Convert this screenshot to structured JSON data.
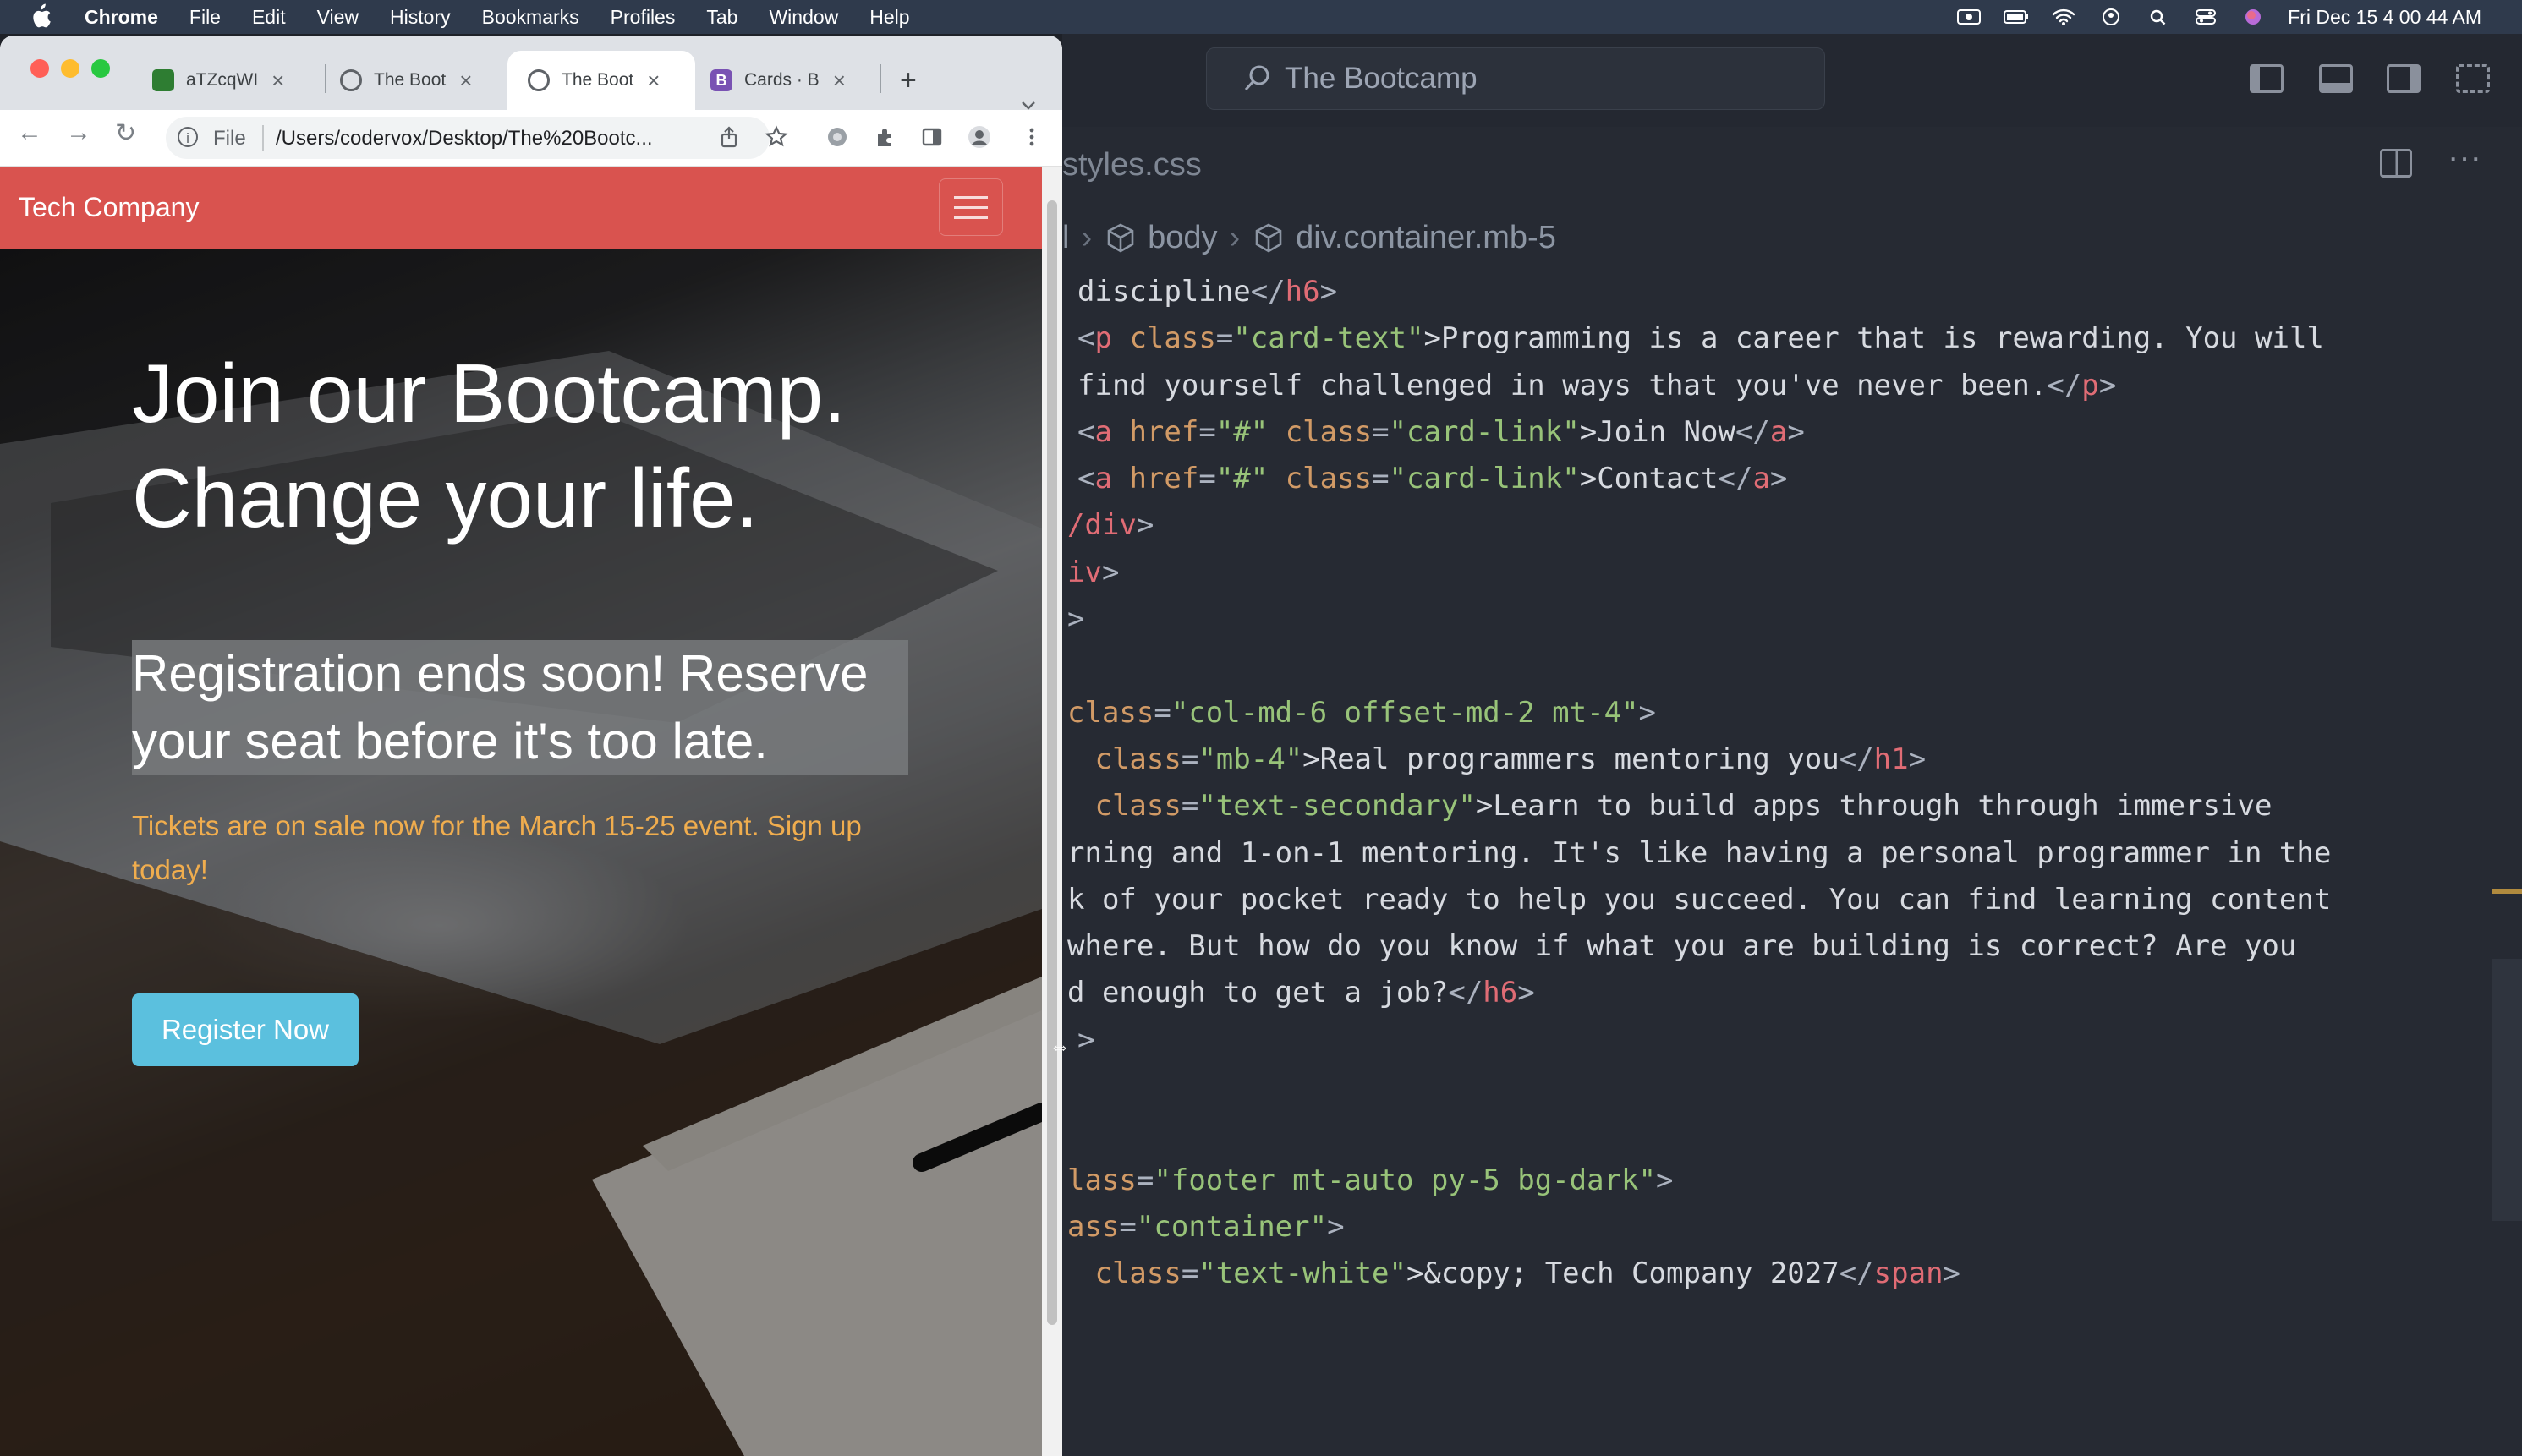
{
  "menubar": {
    "app": "Chrome",
    "items": [
      "File",
      "Edit",
      "View",
      "History",
      "Bookmarks",
      "Profiles",
      "Tab",
      "Window",
      "Help"
    ],
    "clock": "Fri Dec 15  4 00 44 AM"
  },
  "browser": {
    "tabs": [
      {
        "label": "aTZcqWI",
        "active": false,
        "favicon_color": "#2e7d32"
      },
      {
        "label": "The Boot",
        "active": false,
        "favicon_color": "#5f6368"
      },
      {
        "label": "The Boot",
        "active": true,
        "favicon_color": "#5f6368"
      },
      {
        "label": "Cards · B",
        "active": false,
        "favicon_color": "#7952b3"
      }
    ],
    "new_tab": "+",
    "address": {
      "scheme": "File",
      "url": "/Users/codervox/Desktop/The%20Bootc..."
    }
  },
  "page": {
    "brand": "Tech Company",
    "headline_line1": "Join our Bootcamp.",
    "headline_line2": "Change your life.",
    "lead_line1": "Registration ends soon! Reserve",
    "lead_line2": "your seat before it's too late.",
    "tickets_line1": "Tickets are on sale now for the March 15-25 event. Sign up",
    "tickets_line2": "today!",
    "register_button": "Register Now",
    "colors": {
      "navbar": "#d9534f",
      "tickets": "#f0ad4e",
      "button": "#5bc0de"
    }
  },
  "editor": {
    "command_center": "The Bootcamp",
    "tab": "styles.css",
    "breadcrumb": [
      "l",
      "body",
      "div.container.mb-5"
    ],
    "code": [
      [
        {
          "t": "discipline",
          "c": "tx"
        },
        {
          "t": "</",
          "c": "pu"
        },
        {
          "t": "h6",
          "c": "tg"
        },
        {
          "t": ">",
          "c": "pu"
        }
      ],
      [
        {
          "t": "<",
          "c": "pu"
        },
        {
          "t": "p",
          "c": "tg"
        },
        {
          "t": " class",
          "c": "at"
        },
        {
          "t": "=",
          "c": "pu"
        },
        {
          "t": "\"card-text\"",
          "c": "st"
        },
        {
          "t": ">Programming is a career that is rewarding. You will",
          "c": "tx"
        }
      ],
      [
        {
          "t": "find yourself challenged in ways that you've never been.",
          "c": "tx"
        },
        {
          "t": "</",
          "c": "pu"
        },
        {
          "t": "p",
          "c": "tg"
        },
        {
          "t": ">",
          "c": "pu"
        }
      ],
      [
        {
          "t": "<",
          "c": "pu"
        },
        {
          "t": "a",
          "c": "tg"
        },
        {
          "t": " href",
          "c": "at"
        },
        {
          "t": "=",
          "c": "pu"
        },
        {
          "t": "\"#\"",
          "c": "st"
        },
        {
          "t": " class",
          "c": "at"
        },
        {
          "t": "=",
          "c": "pu"
        },
        {
          "t": "\"card-link\"",
          "c": "st"
        },
        {
          "t": ">Join Now",
          "c": "tx"
        },
        {
          "t": "</",
          "c": "pu"
        },
        {
          "t": "a",
          "c": "tg"
        },
        {
          "t": ">",
          "c": "pu"
        }
      ],
      [
        {
          "t": "<",
          "c": "pu"
        },
        {
          "t": "a",
          "c": "tg"
        },
        {
          "t": " href",
          "c": "at"
        },
        {
          "t": "=",
          "c": "pu"
        },
        {
          "t": "\"#\"",
          "c": "st"
        },
        {
          "t": " class",
          "c": "at"
        },
        {
          "t": "=",
          "c": "pu"
        },
        {
          "t": "\"card-link\"",
          "c": "st"
        },
        {
          "t": ">Contact",
          "c": "tx"
        },
        {
          "t": "</",
          "c": "pu"
        },
        {
          "t": "a",
          "c": "tg"
        },
        {
          "t": ">",
          "c": "pu"
        }
      ],
      [
        {
          "t": "/div",
          "c": "tg"
        },
        {
          "t": ">",
          "c": "pu"
        }
      ],
      [
        {
          "t": "iv",
          "c": "tg"
        },
        {
          "t": ">",
          "c": "pu"
        }
      ],
      [
        {
          "t": ">",
          "c": "pu"
        }
      ],
      [],
      [
        {
          "t": "class",
          "c": "at"
        },
        {
          "t": "=",
          "c": "pu"
        },
        {
          "t": "\"col-md-6 offset-md-2 mt-4\"",
          "c": "st"
        },
        {
          "t": ">",
          "c": "pu"
        }
      ],
      [
        {
          "t": " class",
          "c": "at"
        },
        {
          "t": "=",
          "c": "pu"
        },
        {
          "t": "\"mb-4\"",
          "c": "st"
        },
        {
          "t": ">Real programmers mentoring you",
          "c": "tx"
        },
        {
          "t": "</",
          "c": "pu"
        },
        {
          "t": "h1",
          "c": "tg"
        },
        {
          "t": ">",
          "c": "pu"
        }
      ],
      [
        {
          "t": " class",
          "c": "at"
        },
        {
          "t": "=",
          "c": "pu"
        },
        {
          "t": "\"text-secondary\"",
          "c": "st"
        },
        {
          "t": ">Learn to build apps through through immersive",
          "c": "tx"
        }
      ],
      [
        {
          "t": "rning and 1-on-1 mentoring. It's like having a personal programmer in the",
          "c": "tx"
        }
      ],
      [
        {
          "t": "k of your pocket ready to help you succeed. You can find learning content",
          "c": "tx"
        }
      ],
      [
        {
          "t": "where. But how do you know if what you are building is correct? Are you",
          "c": "tx"
        }
      ],
      [
        {
          "t": "d enough to get a job?",
          "c": "tx"
        },
        {
          "t": "</",
          "c": "pu"
        },
        {
          "t": "h6",
          "c": "tg"
        },
        {
          "t": ">",
          "c": "pu"
        }
      ],
      [
        {
          "t": ">",
          "c": "pu"
        }
      ],
      [],
      [],
      [
        {
          "t": "lass",
          "c": "at"
        },
        {
          "t": "=",
          "c": "pu"
        },
        {
          "t": "\"footer mt-auto py-5 bg-dark\"",
          "c": "st"
        },
        {
          "t": ">",
          "c": "pu"
        }
      ],
      [
        {
          "t": "ass",
          "c": "at"
        },
        {
          "t": "=",
          "c": "pu"
        },
        {
          "t": "\"container\"",
          "c": "st"
        },
        {
          "t": ">",
          "c": "pu"
        }
      ],
      [
        {
          "t": " class",
          "c": "at"
        },
        {
          "t": "=",
          "c": "pu"
        },
        {
          "t": "\"text-white\"",
          "c": "st"
        },
        {
          "t": ">&copy; Tech Company 2027",
          "c": "tx"
        },
        {
          "t": "</",
          "c": "pu"
        },
        {
          "t": "span",
          "c": "tg"
        },
        {
          "t": ">",
          "c": "pu"
        }
      ]
    ],
    "line_indent": [
      1,
      1,
      1,
      1,
      1,
      0,
      0,
      0,
      0,
      0,
      1,
      1,
      0,
      0,
      0,
      0,
      1,
      0,
      0,
      0,
      0,
      1
    ]
  }
}
